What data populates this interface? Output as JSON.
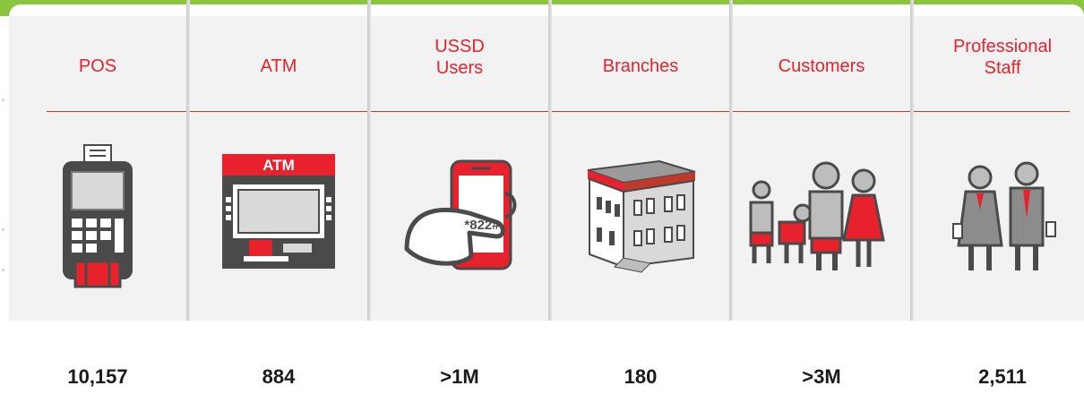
{
  "columns": [
    {
      "label_lines": [
        "POS"
      ],
      "value": "10,157",
      "icon": "pos-terminal-icon"
    },
    {
      "label_lines": [
        "ATM"
      ],
      "value": "884",
      "icon": "atm-icon",
      "icon_text": "ATM"
    },
    {
      "label_lines": [
        "USSD",
        "Users"
      ],
      "value": ">1M",
      "icon": "ussd-phone-icon",
      "icon_text": "*822#"
    },
    {
      "label_lines": [
        "Branches"
      ],
      "value": "180",
      "icon": "branch-building-icon"
    },
    {
      "label_lines": [
        "Customers"
      ],
      "value": ">3M",
      "icon": "customers-family-icon"
    },
    {
      "label_lines": [
        "Professional",
        "Staff"
      ],
      "value": "2,511",
      "icon": "professional-staff-icon"
    }
  ],
  "colors": {
    "accent_red": "#e8222d",
    "top_bar_green": "#8cc63f",
    "panel_gray": "#f2f2f2",
    "icon_dark": "#4a4a4a"
  }
}
